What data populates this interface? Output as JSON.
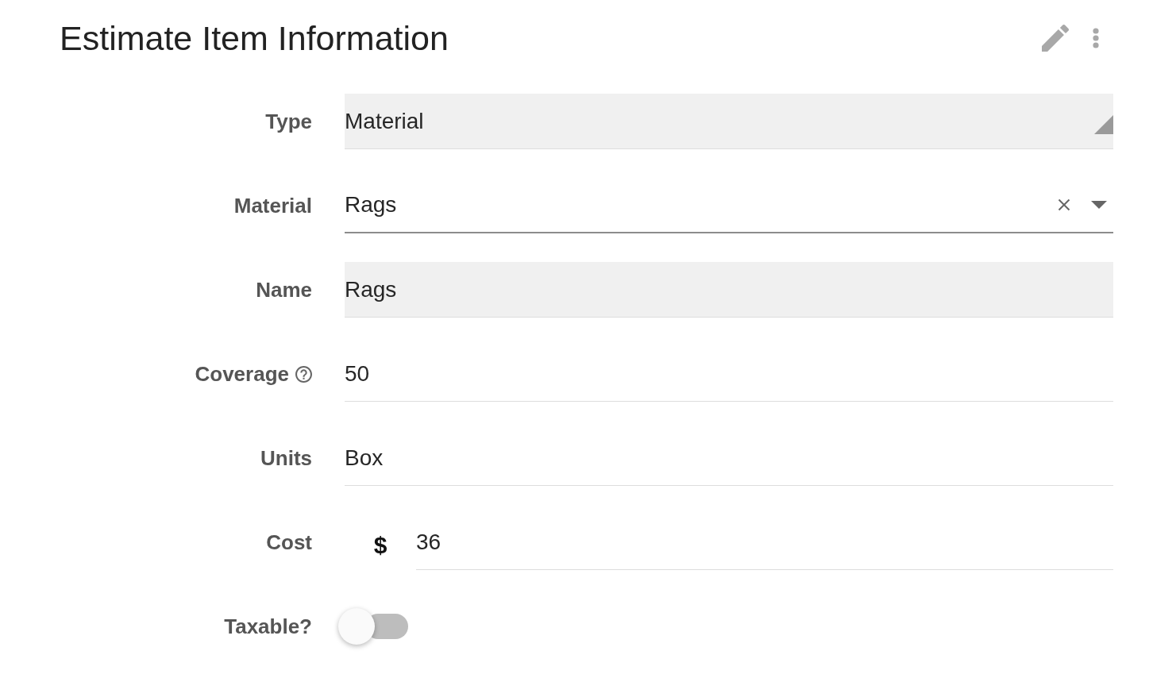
{
  "header": {
    "title": "Estimate Item Information"
  },
  "fields": [
    {
      "label": "Type",
      "kind": "select",
      "value": "Material",
      "help": false
    },
    {
      "label": "Material",
      "kind": "autocomplete",
      "value": "Rags",
      "help": false
    },
    {
      "label": "Name",
      "kind": "readonly",
      "value": "Rags",
      "help": false
    },
    {
      "label": "Coverage",
      "kind": "text",
      "value": "50",
      "help": true
    },
    {
      "label": "Units",
      "kind": "text",
      "value": "Box",
      "help": false
    },
    {
      "label": "Cost",
      "kind": "currency",
      "prefix": "$",
      "value": "36",
      "help": false
    },
    {
      "label": "Taxable?",
      "kind": "toggle",
      "on": false,
      "help": false
    }
  ]
}
